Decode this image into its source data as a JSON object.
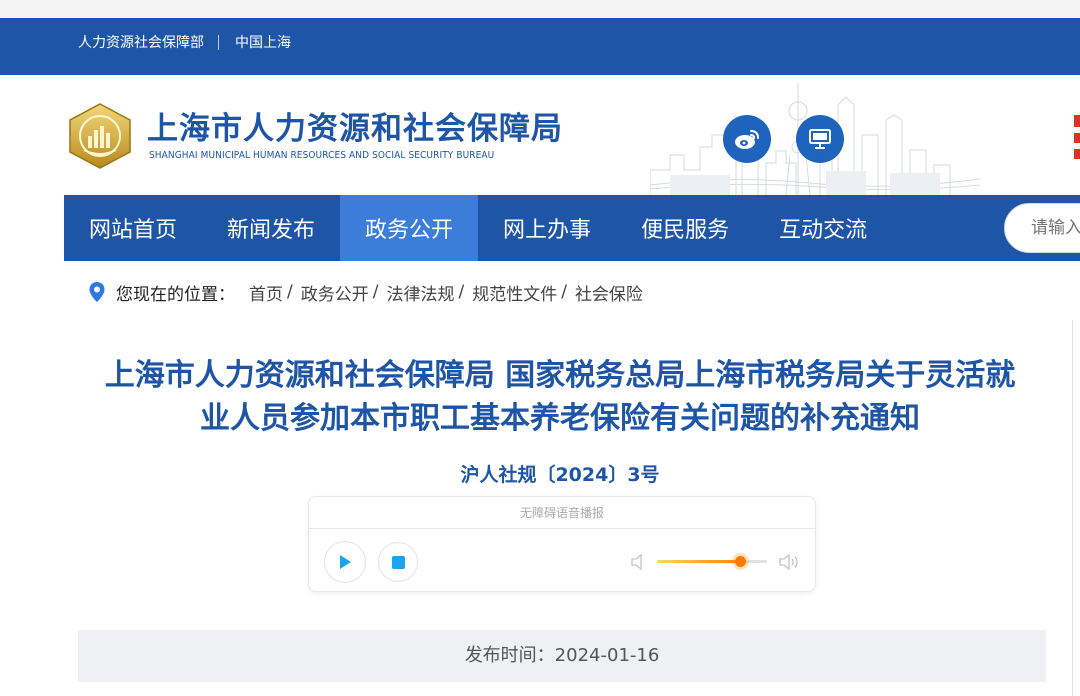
{
  "topbar": {
    "link_ministry": "人力资源社会保障部",
    "link_shanghai": "中国上海"
  },
  "header": {
    "site_name": "上海市人力资源和社会保障局",
    "site_name_en": "SHANGHAI MUNICIPAL HUMAN RESOURCES AND SOCIAL SECURITY BUREAU",
    "social_icons": [
      "weibo-icon",
      "desktop-icon"
    ]
  },
  "nav": {
    "items": [
      {
        "label": "网站首页"
      },
      {
        "label": "新闻发布"
      },
      {
        "label": "政务公开"
      },
      {
        "label": "网上办事"
      },
      {
        "label": "便民服务"
      },
      {
        "label": "互动交流"
      }
    ],
    "active_index": 2,
    "search_placeholder": "请输入"
  },
  "breadcrumb": {
    "here_label": "您现在的位置：",
    "items": [
      "首页",
      "政务公开",
      "法律法规",
      "规范性文件",
      "社会保险"
    ],
    "separator": "/"
  },
  "article": {
    "title_line1": "上海市人力资源和社会保障局 国家税务总局上海市税务局关于灵活就",
    "title_line2": "业人员参加本市职工基本养老保险有关问题的补充通知",
    "doc_number": "沪人社规〔2024〕3号"
  },
  "player": {
    "label": "无障碍语音播报",
    "volume": 0.75
  },
  "publish": {
    "text": "发布时间：2024-01-16"
  },
  "colors": {
    "brand_blue": "#1e55a6",
    "active_nav": "#3b7dd8",
    "play_blue": "#1aa3ef",
    "volume_orange": "#ff7a00"
  }
}
